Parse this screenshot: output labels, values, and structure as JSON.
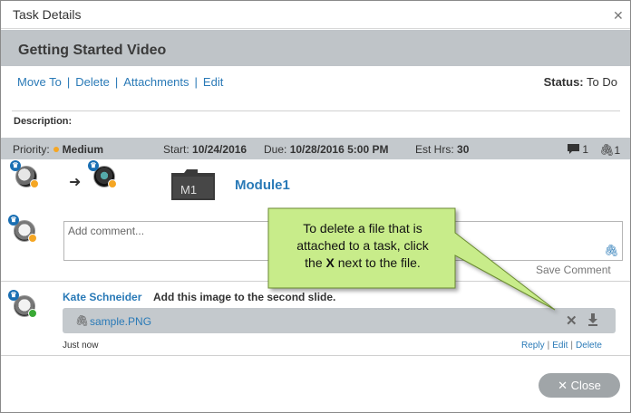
{
  "window": {
    "title": "Task Details"
  },
  "task": {
    "title": "Getting Started Video"
  },
  "actions": {
    "move_to": "Move To",
    "delete": "Delete",
    "attachments": "Attachments",
    "edit": "Edit"
  },
  "status": {
    "label": "Status:",
    "value": "To Do"
  },
  "description": {
    "label": "Description:"
  },
  "info": {
    "priority_label": "Priority:",
    "priority_value": "Medium",
    "start_label": "Start:",
    "start_value": "10/24/2016",
    "due_label": "Due:",
    "due_value": "10/28/2016 5:00 PM",
    "est_label": "Est Hrs:",
    "est_value": "30",
    "comment_count": "1",
    "attachment_count": "1"
  },
  "module": {
    "icon_text": "M1",
    "name": "Module1"
  },
  "comment_input": {
    "placeholder": "Add comment...",
    "save_label": "Save Comment"
  },
  "comment": {
    "author": "Kate Schneider",
    "text": "Add this image to the second slide.",
    "attachment": "sample.PNG",
    "time": "Just now",
    "reply": "Reply",
    "edit": "Edit",
    "delete": "Delete"
  },
  "callout": {
    "line1": "To delete a file that is",
    "line2": "attached to a task, click",
    "line3_pre": "the ",
    "line3_bold": "X",
    "line3_post": " next to the file."
  },
  "footer": {
    "close_label": "Close"
  },
  "colors": {
    "accent": "#2a7ab7",
    "band": "#c4c9cd",
    "callout": "#c8ec8a",
    "priority": "#f5a623",
    "online": "#3aa935"
  }
}
